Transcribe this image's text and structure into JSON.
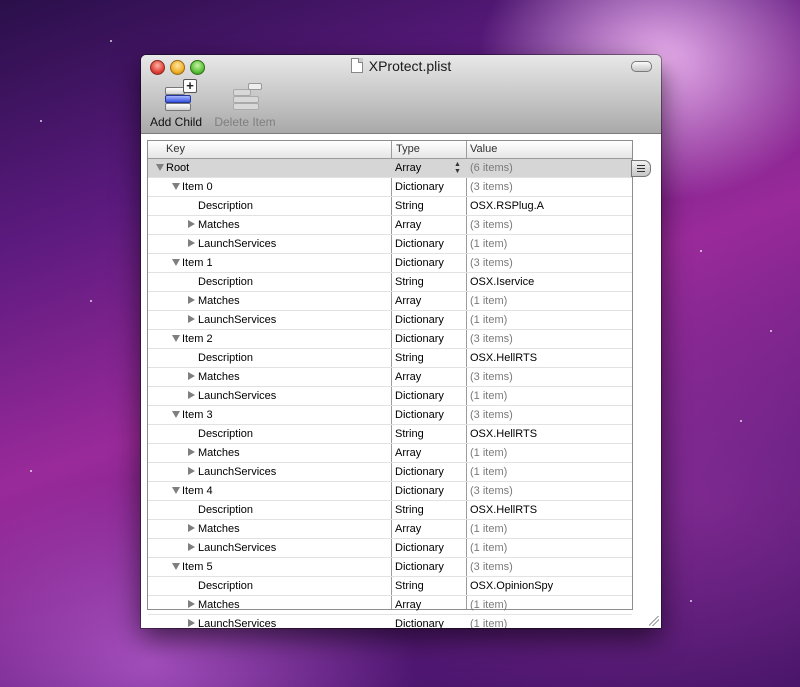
{
  "window": {
    "title": "XProtect.plist"
  },
  "toolbar": {
    "add_child": "Add Child",
    "delete_item": "Delete Item"
  },
  "columns": {
    "key": "Key",
    "type": "Type",
    "value": "Value"
  },
  "rows": [
    {
      "key": "Root",
      "type": "Array",
      "value": "(6 items)",
      "level": 0,
      "disclosure": "open"
    },
    {
      "key": "Item 0",
      "type": "Dictionary",
      "value": "(3 items)",
      "level": 1,
      "disclosure": "open"
    },
    {
      "key": "Description",
      "type": "String",
      "value": "OSX.RSPlug.A",
      "level": 2,
      "disclosure": "none"
    },
    {
      "key": "Matches",
      "type": "Array",
      "value": "(3 items)",
      "level": 2,
      "disclosure": "closed"
    },
    {
      "key": "LaunchServices",
      "type": "Dictionary",
      "value": "(1 item)",
      "level": 2,
      "disclosure": "closed"
    },
    {
      "key": "Item 1",
      "type": "Dictionary",
      "value": "(3 items)",
      "level": 1,
      "disclosure": "open"
    },
    {
      "key": "Description",
      "type": "String",
      "value": "OSX.Iservice",
      "level": 2,
      "disclosure": "none"
    },
    {
      "key": "Matches",
      "type": "Array",
      "value": "(1 item)",
      "level": 2,
      "disclosure": "closed"
    },
    {
      "key": "LaunchServices",
      "type": "Dictionary",
      "value": "(1 item)",
      "level": 2,
      "disclosure": "closed"
    },
    {
      "key": "Item 2",
      "type": "Dictionary",
      "value": "(3 items)",
      "level": 1,
      "disclosure": "open"
    },
    {
      "key": "Description",
      "type": "String",
      "value": "OSX.HellRTS",
      "level": 2,
      "disclosure": "none"
    },
    {
      "key": "Matches",
      "type": "Array",
      "value": "(3 items)",
      "level": 2,
      "disclosure": "closed"
    },
    {
      "key": "LaunchServices",
      "type": "Dictionary",
      "value": "(1 item)",
      "level": 2,
      "disclosure": "closed"
    },
    {
      "key": "Item 3",
      "type": "Dictionary",
      "value": "(3 items)",
      "level": 1,
      "disclosure": "open"
    },
    {
      "key": "Description",
      "type": "String",
      "value": "OSX.HellRTS",
      "level": 2,
      "disclosure": "none"
    },
    {
      "key": "Matches",
      "type": "Array",
      "value": "(1 item)",
      "level": 2,
      "disclosure": "closed"
    },
    {
      "key": "LaunchServices",
      "type": "Dictionary",
      "value": "(1 item)",
      "level": 2,
      "disclosure": "closed"
    },
    {
      "key": "Item 4",
      "type": "Dictionary",
      "value": "(3 items)",
      "level": 1,
      "disclosure": "open"
    },
    {
      "key": "Description",
      "type": "String",
      "value": "OSX.HellRTS",
      "level": 2,
      "disclosure": "none"
    },
    {
      "key": "Matches",
      "type": "Array",
      "value": "(1 item)",
      "level": 2,
      "disclosure": "closed"
    },
    {
      "key": "LaunchServices",
      "type": "Dictionary",
      "value": "(1 item)",
      "level": 2,
      "disclosure": "closed"
    },
    {
      "key": "Item 5",
      "type": "Dictionary",
      "value": "(3 items)",
      "level": 1,
      "disclosure": "open"
    },
    {
      "key": "Description",
      "type": "String",
      "value": "OSX.OpinionSpy",
      "level": 2,
      "disclosure": "none"
    },
    {
      "key": "Matches",
      "type": "Array",
      "value": "(1 item)",
      "level": 2,
      "disclosure": "closed"
    },
    {
      "key": "LaunchServices",
      "type": "Dictionary",
      "value": "(1 item)",
      "level": 2,
      "disclosure": "closed"
    }
  ]
}
